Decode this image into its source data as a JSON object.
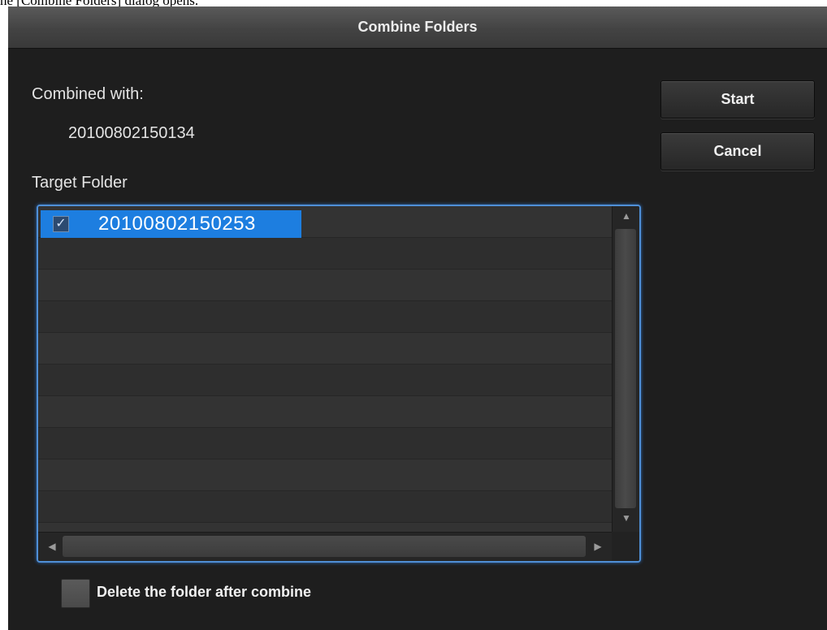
{
  "caption": "he [Combine Folders] dialog opens.",
  "dialog": {
    "title": "Combine Folders",
    "combined_with_label": "Combined with:",
    "combined_with_value": "20100802150134",
    "target_folder_label": "Target Folder",
    "start_label": "Start",
    "cancel_label": "Cancel"
  },
  "target_list": {
    "items": [
      {
        "label": "20100802150253",
        "checked": true,
        "selected": true
      }
    ]
  },
  "delete_option": {
    "label": "Delete the folder after combine",
    "checked": false
  },
  "colors": {
    "selection": "#1d7ee0",
    "focus_ring": "#4f8fd6",
    "dialog_bg": "#1e1e1e"
  }
}
